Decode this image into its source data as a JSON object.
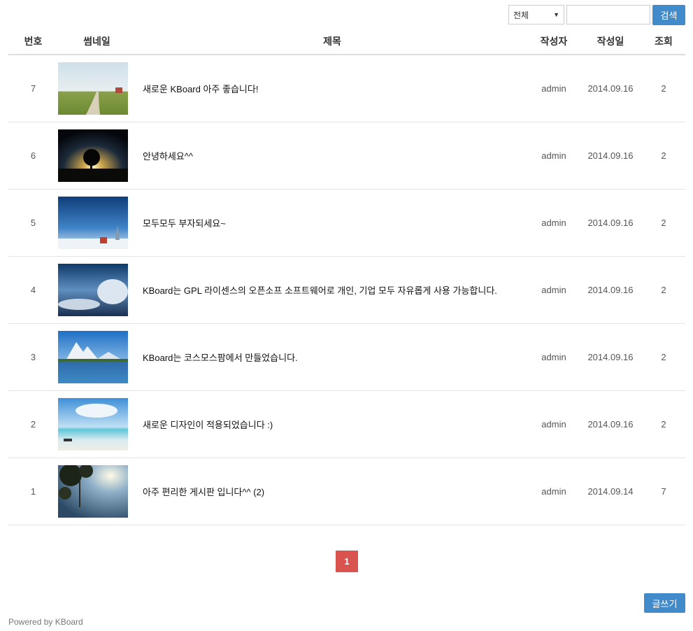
{
  "search": {
    "select_value": "전체",
    "button_label": "검색",
    "input_value": ""
  },
  "table": {
    "headers": {
      "no": "번호",
      "thumb": "썸네일",
      "title": "제목",
      "author": "작성자",
      "date": "작성일",
      "views": "조회"
    },
    "rows": [
      {
        "no": "7",
        "title": "새로운 KBoard 아주 좋습니다!",
        "author": "admin",
        "date": "2014.09.16",
        "views": "2",
        "thumb": "field-path"
      },
      {
        "no": "6",
        "title": "안녕하세요^^",
        "author": "admin",
        "date": "2014.09.16",
        "views": "2",
        "thumb": "tree-sunset"
      },
      {
        "no": "5",
        "title": "모두모두 부자되세요~",
        "author": "admin",
        "date": "2014.09.16",
        "views": "2",
        "thumb": "winter-house"
      },
      {
        "no": "4",
        "title": "KBoard는 GPL 라이센스의 오픈소프 소프트웨어로 개인, 기업 모두 자유롭게 사용 가능합니다.",
        "author": "admin",
        "date": "2014.09.16",
        "views": "2",
        "thumb": "cloud-sky"
      },
      {
        "no": "3",
        "title": "KBoard는 코스모스팜에서 만들었습니다.",
        "author": "admin",
        "date": "2014.09.16",
        "views": "2",
        "thumb": "mountain-lake"
      },
      {
        "no": "2",
        "title": "새로운 디자인이 적용되었습니다 :)",
        "author": "admin",
        "date": "2014.09.16",
        "views": "2",
        "thumb": "beach"
      },
      {
        "no": "1",
        "title": "아주 편리한 게시판 입니다^^ (2)",
        "author": "admin",
        "date": "2014.09.14",
        "views": "7",
        "thumb": "leaves-sky"
      }
    ]
  },
  "pagination": {
    "current": "1"
  },
  "write_button": "글쓰기",
  "footer": {
    "powered": "Powered by KBoard"
  },
  "colors": {
    "primary": "#428bca",
    "active_page": "#d9534f"
  }
}
